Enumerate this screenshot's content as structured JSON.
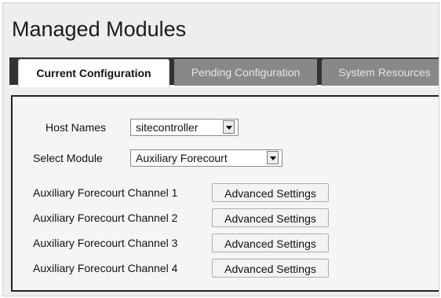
{
  "page": {
    "title": "Managed Modules"
  },
  "tabs": [
    {
      "label": "Current Configuration",
      "active": true
    },
    {
      "label": "Pending Configuration",
      "active": false
    },
    {
      "label": "System Resources",
      "active": false
    }
  ],
  "form": {
    "host_label": "Host Names",
    "host_value": "sitecontroller",
    "module_label": "Select Module",
    "module_value": "Auxiliary Forecourt"
  },
  "channels": [
    {
      "label": "Auxiliary Forecourt Channel 1",
      "button": "Advanced Settings"
    },
    {
      "label": "Auxiliary Forecourt Channel 2",
      "button": "Advanced Settings"
    },
    {
      "label": "Auxiliary Forecourt Channel 3",
      "button": "Advanced Settings"
    },
    {
      "label": "Auxiliary Forecourt Channel 4",
      "button": "Advanced Settings"
    }
  ],
  "colors": {
    "tab_bar": "#333333",
    "tab_inactive": "#888888",
    "tab_active": "#ffffff",
    "panel_border": "#222222",
    "background": "#eeeeee"
  }
}
